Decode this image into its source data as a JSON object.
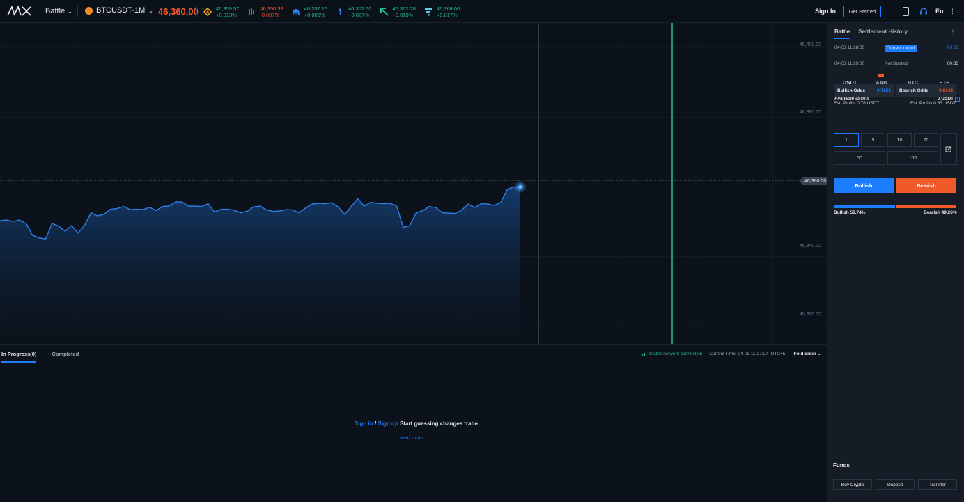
{
  "header": {
    "battle_label": "Battle",
    "pair": "BTCUSDT-1M",
    "price": "46,360.00",
    "tickers": [
      {
        "icon": "binance-icon",
        "price": "46,359.57",
        "change": "+0.013%",
        "dir": "up"
      },
      {
        "icon": "bitfinex-icon",
        "price": "46,350.58",
        "change": "-0.007%",
        "dir": "down"
      },
      {
        "icon": "kraken-icon",
        "price": "46,357.15",
        "change": "+0.005%",
        "dir": "up"
      },
      {
        "icon": "huobi-icon",
        "price": "46,362.50",
        "change": "+0.027%",
        "dir": "up"
      },
      {
        "icon": "kucoin-icon",
        "price": "46,362.28",
        "change": "+0.013%",
        "dir": "up"
      },
      {
        "icon": "ftx-icon",
        "price": "46,368.00",
        "change": "+0.017%",
        "dir": "up"
      }
    ],
    "sign_in": "Sign In",
    "get_started": "Get Started",
    "lang": "En"
  },
  "chart": {
    "y_ticks": [
      "46,400.00",
      "46,380.00",
      "46,360.00",
      "46,340.00",
      "46,320.00"
    ],
    "current_price": "46,360.00"
  },
  "chart_data": {
    "type": "area",
    "ylim": [
      46315,
      46407
    ],
    "y_ticks": [
      46400,
      46380,
      46360,
      46340,
      46320
    ],
    "series": [
      {
        "values": [
          46350.3,
          46350.5,
          46350.1,
          46350.5,
          46349.5,
          46346.2,
          46345.4,
          46345.1,
          46349.5,
          46348.8,
          46347.3,
          46348.9,
          46346.8,
          46349.0,
          46352.6,
          46351.7,
          46352.2,
          46353.6,
          46353.8,
          46354.4,
          46353.5,
          46353.6,
          46353.5,
          46354.2,
          46353.2,
          46354.4,
          46354.5,
          46355.7,
          46355.7,
          46354.5,
          46354.5,
          46354.4,
          46355.2,
          46352.8,
          46353.6,
          46353.6,
          46353.3,
          46352.6,
          46353.0,
          46354.3,
          46354.5,
          46353.4,
          46353.0,
          46353.1,
          46353.5,
          46353.4,
          46352.6,
          46354.0,
          46355.1,
          46355.3,
          46355.2,
          46355.5,
          46354.3,
          46352.1,
          46354.4,
          46356.6,
          46354.5,
          46355.6,
          46355.3,
          46355.2,
          46355.3,
          46354.5,
          46348.4,
          46348.9,
          46352.6,
          46353.2,
          46354.4,
          46354.1,
          46352.6,
          46352.5,
          46352.4,
          46353.4,
          46355.1,
          46354.1,
          46355.2,
          46355.1,
          46354.7,
          46355.6,
          46359.3,
          46360.0,
          46360.0
        ]
      }
    ],
    "current_price": 46360
  },
  "bottom": {
    "tab_in_progress": "In Progress(0)",
    "tab_completed": "Completed",
    "network": "Stable network connection",
    "current_time": "Current Time: 04-03 11:27:27 (UTC+5)",
    "fold_order": "Fold order",
    "sign_in": "Sign in",
    "slash": "/",
    "sign_up": "Sign up",
    "msg": "Start guessing changes trade.",
    "read_more": "read more"
  },
  "panel": {
    "tab_battle": "Battle",
    "tab_history": "Settlement History",
    "more": "⋮",
    "rounds": [
      {
        "time": "04-03 11:28:00",
        "status": "Current round",
        "countdown": "00:03"
      },
      {
        "time": "04-03 11:29:00",
        "status": "Not Started",
        "countdown": "00:33"
      }
    ],
    "currencies": [
      "USDT",
      "AAB",
      "BTC",
      "ETH"
    ],
    "available_label": "Available assets",
    "available_value": "0 USDT",
    "plus": "+",
    "bull_odds_label": "Bullish Odds",
    "bull_odds_value": "0.7656",
    "bear_odds_label": "Bearish Odds",
    "bear_odds_value": "0.8348",
    "est_left": "Est. Profits 0.76 USDT",
    "est_right": "Est. Profits 0.83 USDT",
    "amounts": [
      "1",
      "5",
      "10",
      "20",
      "50",
      "100"
    ],
    "bullish_btn": "Bullish",
    "bearish_btn": "Bearish",
    "bull_pct_label": "Bullish 50.74%",
    "bear_pct_label": "Bearish 49.26%",
    "bull_pct": 0.5074,
    "funds_title": "Funds",
    "funds_buttons": [
      "Buy Crypto",
      "Deposit",
      "Transfer"
    ]
  },
  "colors": {
    "accent": "#1e7cff",
    "bearish": "#f05a2a",
    "up": "#1fbf8f",
    "bg": "#0c121b",
    "panel": "#161c26"
  }
}
